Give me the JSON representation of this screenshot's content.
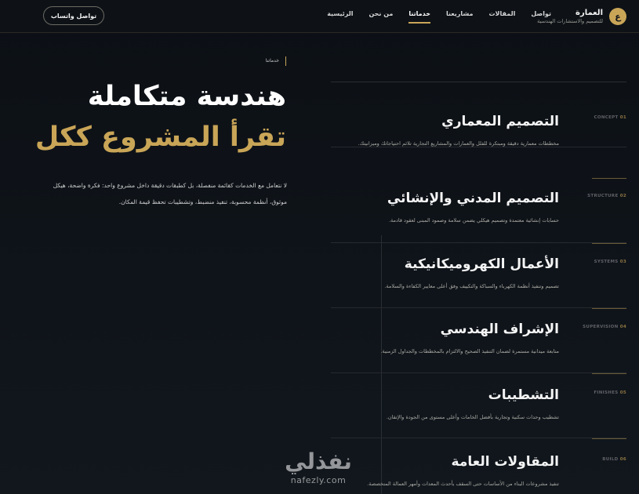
{
  "header": {
    "brand_badge": "ع",
    "brand_name": "العمارة",
    "brand_sub": "للتصميم والاستشارات الهندسية",
    "nav": [
      {
        "label": "الرئيسية"
      },
      {
        "label": "من نحن"
      },
      {
        "label": "خدماتنا",
        "active": true
      },
      {
        "label": "مشاريعنا"
      },
      {
        "label": "المقالات"
      },
      {
        "label": "تواصل"
      }
    ],
    "cta_label": "تواصل واتساب"
  },
  "hero": {
    "tag": "خدماتنا",
    "title_line1": "هندسة متكاملة",
    "title_line2": "تقرأ المشروع ككل",
    "description": "لا نتعامل مع الخدمات كقائمة منفصلة، بل كطبقات دقيقة داخل مشروع واحد: فكرة واضحة، هيكل موثوق، أنظمة محسوبة، تنفيذ منضبط، وتشطيبات تحفظ قيمة المكان."
  },
  "services": [
    {
      "title": "التصميم المعماري",
      "desc": "مخططات معمارية دقيقة ومبتكرة للفلل والعمارات والمشاريع التجارية تلائم احتياجاتك وميزانيتك.",
      "code": "CONCEPT",
      "num": "01"
    },
    {
      "title": "التصميم المدني والإنشائي",
      "desc": "حسابات إنشائية معتمدة وتصميم هيكلي يضمن سلامة وصمود المبنى لعقود قادمة.",
      "code": "STRUCTURE",
      "num": "02"
    },
    {
      "title": "الأعمال الكهروميكانيكية",
      "desc": "تصميم وتنفيذ أنظمة الكهرباء والسباكة والتكييف وفق أعلى معايير الكفاءة والسلامة.",
      "code": "SYSTEMS",
      "num": "03"
    },
    {
      "title": "الإشراف الهندسي",
      "desc": "متابعة ميدانية مستمرة لضمان التنفيذ الصحيح والالتزام بالمخططات والجداول الزمنية.",
      "code": "SUPERVISION",
      "num": "04"
    },
    {
      "title": "التشطيبات",
      "desc": "تشطيب وحدات سكنية وتجارية بأفضل الخامات وأعلى مستوى من الجودة والإتقان.",
      "code": "FINISHES",
      "num": "05"
    },
    {
      "title": "المقاولات العامة",
      "desc": "تنفيذ مشروعات البناء من الأساسات حتى السقف بأحدث المعدات وأمهر العمالة المتخصصة.",
      "code": "BUILD",
      "num": "06"
    }
  ],
  "watermark": {
    "arabic": "نفذلي",
    "latin": "nafezly.com"
  },
  "colors": {
    "accent_gold": "#c9a557",
    "background": "#0e1217"
  }
}
